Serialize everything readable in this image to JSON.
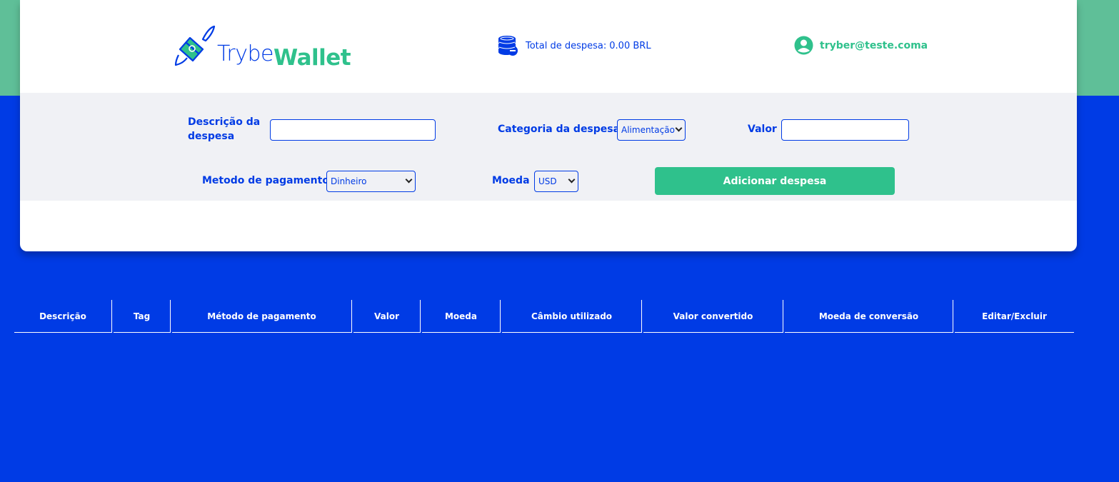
{
  "header": {
    "logo": {
      "part1": "Trybe",
      "part2": "Wallet"
    },
    "total_label": "Total de despesa:",
    "total_value": "0.00",
    "total_currency": "BRL",
    "user_email": "tryber@teste.coma"
  },
  "form": {
    "description_label": "Descrição da despesa",
    "description_value": "",
    "category_label": "Categoria da despesa",
    "category_selected": "Alimentação",
    "value_label": "Valor",
    "value_value": "",
    "payment_label": "Metodo de pagamento",
    "payment_selected": "Dinheiro",
    "currency_label": "Moeda",
    "currency_selected": "USD",
    "add_button": "Adicionar despesa"
  },
  "table": {
    "headers": [
      "Descrição",
      "Tag",
      "Método de pagamento",
      "Valor",
      "Moeda",
      "Câmbio utilizado",
      "Valor convertido",
      "Moeda de conversão",
      "Editar/Excluir"
    ]
  },
  "colors": {
    "primary_blue": "#003be5",
    "green": "#2fc18c",
    "light_green": "#5fbf98",
    "form_bg": "#f0f1f5"
  }
}
